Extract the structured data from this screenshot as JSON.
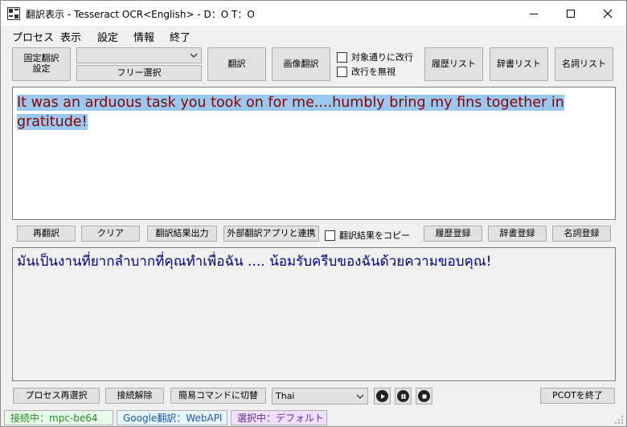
{
  "title": "翻訳表示 - Tesseract OCR<English> - D：O T：O",
  "menu": [
    "プロセス",
    "表示",
    "設定",
    "情報",
    "終了"
  ],
  "toolbar": {
    "fixed_translate": "固定翻訳\n設定",
    "combo_value": "",
    "free_select": "フリー選択",
    "translate": "翻訳",
    "image_translate": "画像翻訳",
    "check_target_linebreak": "対象通りに改行",
    "check_ignore_linebreak": "改行を無視",
    "history_list": "履歴リスト",
    "dict_list": "辞書リスト",
    "noun_list": "名詞リスト"
  },
  "source_text": "It was an arduous task you took on for me....humbly bring my fins together in gratitude!",
  "middle_bar": {
    "retranslate": "再翻訳",
    "clear": "クリア",
    "output_result": "翻訳結果出力",
    "external_app": "外部翻訳アプリと連携",
    "copy_result": "翻訳結果をコピー",
    "history_register": "履歴登録",
    "dict_register": "辞書登録",
    "noun_register": "名詞登録"
  },
  "translated_text": "มันเป็นงานที่ยากลำบากที่คุณทำเพื่อฉัน .... น้อมรับครีบของฉันด้วยความขอบคุณ!",
  "bottom_bar": {
    "reselect_process": "プロセス再選択",
    "disconnect": "接続解除",
    "simple_command": "簡易コマンドに切替",
    "language": "Thai",
    "quit": "PCOTを終了"
  },
  "status": {
    "connected": "接続中：mpc-be64",
    "google": "Google翻訳：WebAPI",
    "selected": "選択中：デフォルト"
  },
  "colors": {
    "source_text": "#8b0000",
    "selection": "#99c9ef",
    "translated_text": "#000080",
    "status_connected_bg": "#e8fbe8",
    "status_google_bg": "#e8f4ff",
    "status_selected_bg": "#efe0ff"
  },
  "icons": [
    "app-icon",
    "minimize-icon",
    "maximize-icon",
    "close-icon",
    "chevron-down-icon",
    "play-icon",
    "pause-icon",
    "stop-icon"
  ]
}
